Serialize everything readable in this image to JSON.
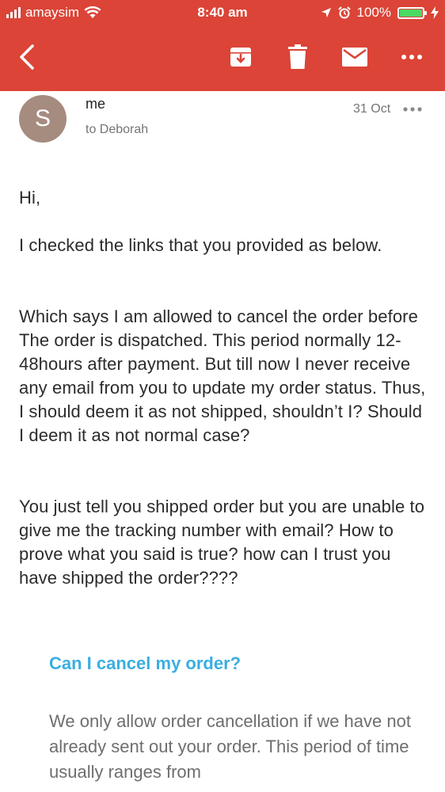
{
  "status_bar": {
    "carrier": "amaysim",
    "time": "8:40 am",
    "battery": "100%",
    "battery_level": 1.0
  },
  "toolbar": {
    "icons": [
      "back-arrow-icon",
      "archive-icon",
      "trash-icon",
      "mail-icon",
      "more-horizontal-icon"
    ],
    "accent_color": "#DB4437"
  },
  "email": {
    "avatar_initial": "S",
    "sender": "me",
    "recipient": "to Deborah",
    "date": "31 Oct",
    "body": [
      "Hi,",
      "I checked the links that you provided as below.",
      "Which says I am allowed to cancel the order before The order is dispatched. This period normally 12-48hours after payment. But till now I never receive any email from you to update my order status. Thus, I should deem it as not shipped, shouldn’t I? Should I deem it as not normal case?",
      "You just tell you shipped order but you are unable to give me the tracking number with email? How to prove what you said is true? how can I trust you have shipped the order????"
    ],
    "quoted": {
      "title": "Can I cancel my order?",
      "text": "We only allow order cancellation if we have not already sent out your order. This period of time usually ranges from"
    }
  }
}
